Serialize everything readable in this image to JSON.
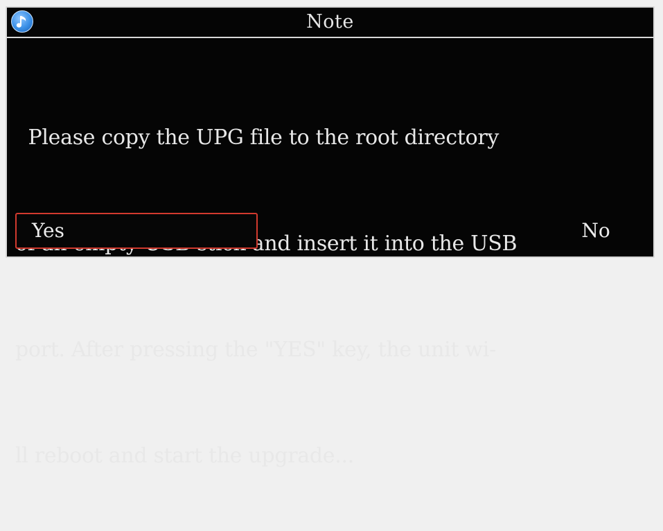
{
  "dialog": {
    "title": "Note",
    "icon": "music-note-icon",
    "message_lines": [
      "  Please copy the UPG file to the root directory",
      "of an empty USB stick and insert it into the USB",
      "port. After pressing the \"YES\" key, the unit wi-",
      "ll reboot and start the upgrade..."
    ],
    "yes_label": "Yes",
    "no_label": "No",
    "selected_button": "Yes",
    "accent_color": "#d23a2e"
  }
}
